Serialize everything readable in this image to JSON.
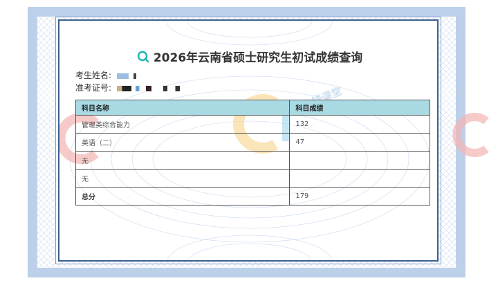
{
  "page": {
    "title": "2026年云南省硕士研究生初试成绩查询",
    "name_label": "考生姓名:",
    "id_label": "准考证号:"
  },
  "table": {
    "headers": [
      "科目名称",
      "科目成绩"
    ],
    "rows": [
      [
        "管理类综合能力",
        "132"
      ],
      [
        "英语（二）",
        "47"
      ],
      [
        "无",
        ""
      ],
      [
        "无",
        ""
      ],
      [
        "总分",
        "179"
      ]
    ]
  },
  "watermark": {
    "brand_text": "达大钱课堂"
  },
  "colors": {
    "header_bg": "#a9d9e3",
    "frame": "#3a5f8f",
    "title_icon": "#1fb5b0"
  }
}
